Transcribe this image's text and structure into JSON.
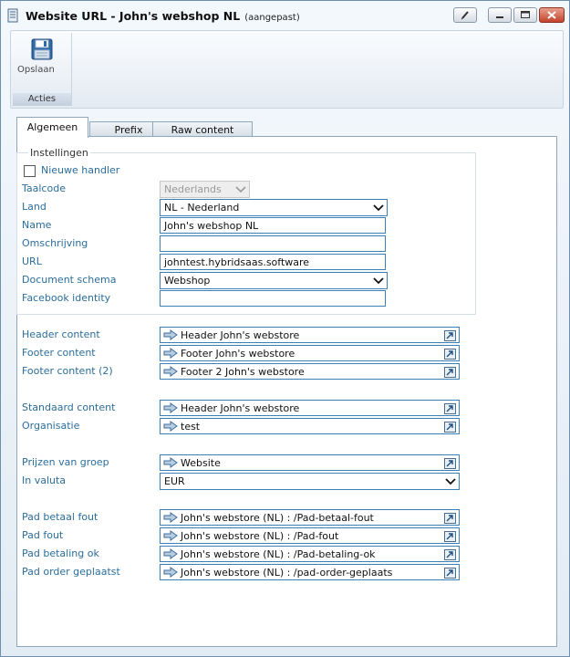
{
  "window": {
    "title": "Website URL - John's webshop NL",
    "state": "(aangepast)"
  },
  "toolbar": {
    "save_label": "Opslaan",
    "group_label": "Acties"
  },
  "tabs": [
    {
      "label": "Algemeen",
      "active": true
    },
    {
      "label": "Prefix",
      "active": false
    },
    {
      "label": "Raw content",
      "active": false
    }
  ],
  "settings": {
    "legend": "Instellingen",
    "new_handler_label": "Nieuwe handler",
    "new_handler_checked": false,
    "language_code_label": "Taalcode",
    "language_code_value": "Nederlands",
    "country_label": "Land",
    "country_value": "NL - Nederland",
    "name_label": "Name",
    "name_value": "John's webshop NL",
    "description_label": "Omschrijving",
    "description_value": "",
    "url_label": "URL",
    "url_value": "johntest.hybridsaas.software",
    "document_schema_label": "Document schema",
    "document_schema_value": "Webshop",
    "facebook_label": "Facebook identity",
    "facebook_value": ""
  },
  "content": {
    "header_label": "Header content",
    "header_value": "Header John's webstore",
    "footer_label": "Footer content",
    "footer_value": "Footer John's webstore",
    "footer2_label": "Footer content (2)",
    "footer2_value": "Footer 2 John's webstore"
  },
  "defaults": {
    "standard_label": "Standaard content",
    "standard_value": "Header John's webstore",
    "organisation_label": "Organisatie",
    "organisation_value": "test"
  },
  "pricing": {
    "group_label": "Prijzen van groep",
    "group_value": "Website",
    "currency_label": "In valuta",
    "currency_value": "EUR"
  },
  "paths": {
    "pay_error_label": "Pad betaal fout",
    "pay_error_value": "John's webstore (NL) : /Pad-betaal-fout",
    "error_label": "Pad fout",
    "error_value": "John's webstore (NL) : /Pad-fout",
    "pay_ok_label": "Pad betaling ok",
    "pay_ok_value": "John's webstore (NL) : /Pad-betaling-ok",
    "order_placed_label": "Pad order geplaatst",
    "order_placed_value": "John's webstore (NL) : /pad-order-geplaats"
  },
  "icons": {
    "app": "document-icon",
    "save": "floppy-disk-icon",
    "link": "arrow-right-icon",
    "open": "open-external-icon",
    "dropdown": "chevron-down-icon"
  },
  "colors": {
    "label": "#2a6d9b",
    "input_border": "#3a7fb8",
    "window_background": "#dde9f3"
  }
}
